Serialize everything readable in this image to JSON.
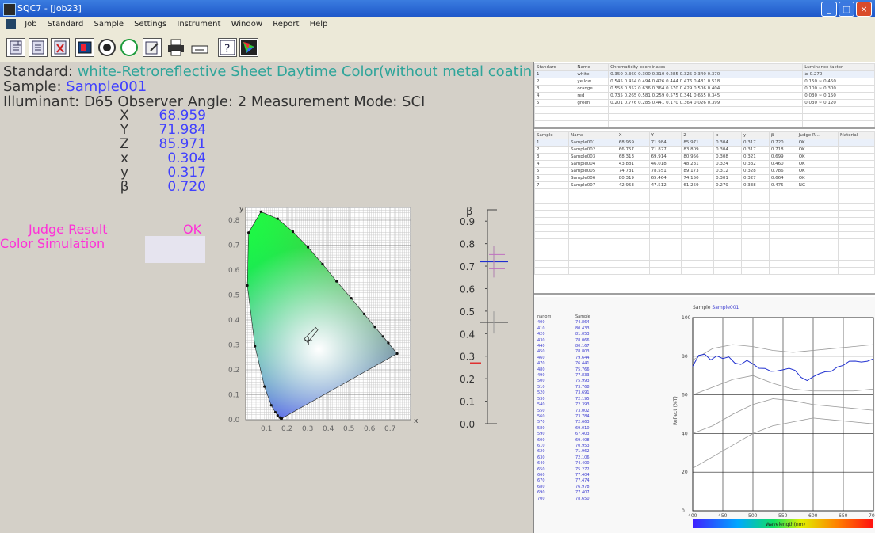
{
  "window": {
    "title": "SQC7 - [Job23]",
    "minimize": "_",
    "maximize": "□",
    "close": "×"
  },
  "menu": [
    "Job",
    "Standard",
    "Sample",
    "Settings",
    "Instrument",
    "Window",
    "Report",
    "Help"
  ],
  "toolbar_icons": [
    "new-job-icon",
    "open-job-icon",
    "delete-icon",
    "image-icon",
    "radio-filled-icon",
    "radio-empty-icon",
    "edit-icon",
    "print-icon",
    "print-preview-icon",
    "help-icon",
    "color-palette-icon"
  ],
  "info": {
    "standard_label": "Standard:",
    "standard_value": "white-Retroreflective Sheet Daytime Color(without metal coating)",
    "sample_label": "Sample:",
    "sample_value": "Sample001",
    "conditions": "Illuminant: D65  Observer Angle: 2  Measurement Mode: SCI"
  },
  "measurements": [
    {
      "label": "X",
      "value": "68.959"
    },
    {
      "label": "Y",
      "value": "71.984"
    },
    {
      "label": "Z",
      "value": "85.971"
    },
    {
      "label": "x",
      "value": "0.304"
    },
    {
      "label": "y",
      "value": "0.317"
    },
    {
      "label": "β",
      "value": "0.720"
    }
  ],
  "judge": {
    "label": "Judge Result",
    "value": "OK",
    "sim_label": "Color Simulation",
    "swatch_color": "#e6e4ef"
  },
  "chromaticity": {
    "xlabel": "x",
    "ylabel": "y",
    "xticks": [
      "0.1",
      "0.2",
      "0.3",
      "0.4",
      "0.5",
      "0.6",
      "0.7"
    ],
    "yticks": [
      "0.0",
      "0.1",
      "0.2",
      "0.3",
      "0.4",
      "0.5",
      "0.6",
      "0.7",
      "0.8"
    ],
    "sample_point": {
      "x": 0.304,
      "y": 0.317
    }
  },
  "beta_scale": {
    "label": "β",
    "ticks": [
      "0.0",
      "0.1",
      "0.2",
      "0.3",
      "0.4",
      "0.5",
      "0.6",
      "0.7",
      "0.8",
      "0.9"
    ],
    "sample_value": 0.72,
    "std_upper": 0.45,
    "marker_low": 0.27
  },
  "standard_table": {
    "headers": [
      "Standard",
      "Name",
      "Chromaticity coordinates",
      "Luminance factor"
    ],
    "rows": [
      [
        "1",
        "white",
        "0.350 0.360  0.300 0.310  0.285 0.325  0.340 0.370",
        "≥ 0.270"
      ],
      [
        "2",
        "yellow",
        "0.545 0.454  0.494 0.426  0.444 0.476  0.481 0.518",
        "0.150 ~ 0.450"
      ],
      [
        "3",
        "orange",
        "0.558 0.352  0.636 0.364  0.570 0.429  0.506 0.404",
        "0.100 ~ 0.300"
      ],
      [
        "4",
        "red",
        "0.735 0.265  0.581 0.259  0.575 0.341  0.655 0.345",
        "0.030 ~ 0.150"
      ],
      [
        "5",
        "green",
        "0.201 0.776  0.285 0.441  0.170 0.364  0.026 0.399",
        "0.030 ~ 0.120"
      ]
    ]
  },
  "sample_table": {
    "headers": [
      "Sample",
      "Name",
      "X",
      "Y",
      "Z",
      "x",
      "y",
      "β",
      "Judge R...",
      "Material"
    ],
    "rows": [
      [
        "1",
        "Sample001",
        "68.959",
        "71.984",
        "85.971",
        "0.304",
        "0.317",
        "0.720",
        "OK",
        ""
      ],
      [
        "2",
        "Sample002",
        "66.757",
        "71.827",
        "83.809",
        "0.304",
        "0.317",
        "0.718",
        "OK",
        ""
      ],
      [
        "3",
        "Sample003",
        "68.313",
        "69.914",
        "80.956",
        "0.308",
        "0.321",
        "0.699",
        "OK",
        ""
      ],
      [
        "4",
        "Sample004",
        "43.881",
        "46.018",
        "48.231",
        "0.324",
        "0.332",
        "0.460",
        "OK",
        ""
      ],
      [
        "5",
        "Sample005",
        "74.731",
        "78.551",
        "89.173",
        "0.312",
        "0.328",
        "0.786",
        "OK",
        ""
      ],
      [
        "6",
        "Sample006",
        "80.319",
        "65.464",
        "74.150",
        "0.301",
        "0.327",
        "0.664",
        "OK",
        ""
      ],
      [
        "7",
        "Sample007",
        "42.953",
        "47.512",
        "61.259",
        "0.279",
        "0.338",
        "0.475",
        "NG",
        ""
      ]
    ]
  },
  "spectral": {
    "title": "Sample",
    "sample_name": "Sample001",
    "col1_header": "nanom",
    "col2_header": "Sample",
    "ylabel": "Reflect (%T)",
    "xlabel": "Wavelength(nm)",
    "wavelengths": [
      "400",
      "410",
      "420",
      "430",
      "440",
      "450",
      "460",
      "470",
      "480",
      "490",
      "500",
      "510",
      "520",
      "530",
      "540",
      "550",
      "560",
      "570",
      "580",
      "590",
      "600",
      "610",
      "620",
      "630",
      "640",
      "650",
      "660",
      "670",
      "680",
      "690",
      "700"
    ],
    "values": [
      "74.864",
      "80.433",
      "81.053",
      "78.066",
      "80.167",
      "78.803",
      "79.644",
      "76.441",
      "75.766",
      "77.833",
      "75.993",
      "73.768",
      "73.691",
      "72.195",
      "72.393",
      "73.002",
      "73.784",
      "72.663",
      "69.010",
      "67.403",
      "69.408",
      "70.953",
      "71.962",
      "72.106",
      "74.400",
      "75.272",
      "77.404",
      "77.474",
      "76.978",
      "77.407",
      "78.650"
    ],
    "xticks": [
      "400",
      "450",
      "500",
      "550",
      "600",
      "650",
      "700"
    ],
    "yticks": [
      "0",
      "20",
      "40",
      "60",
      "80",
      "100"
    ]
  }
}
